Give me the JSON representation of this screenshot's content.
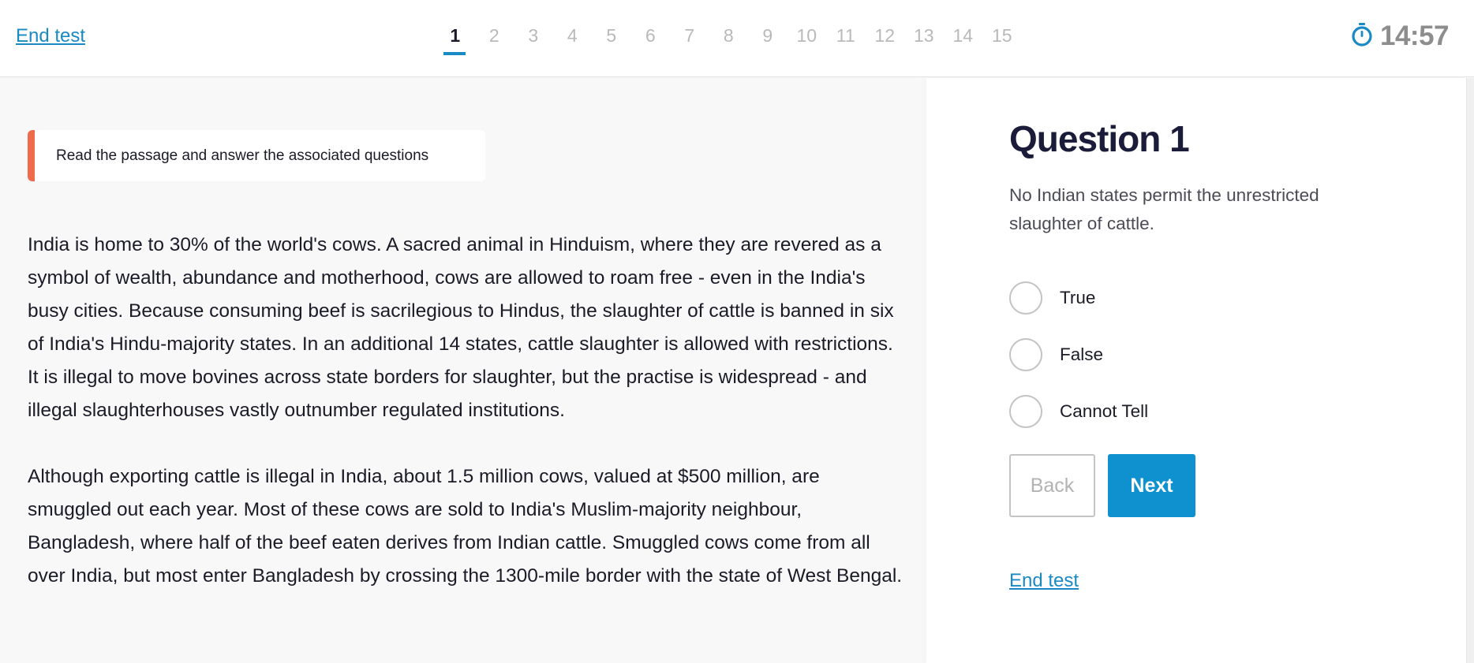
{
  "header": {
    "end_test_label": "End test",
    "question_numbers": [
      "1",
      "2",
      "3",
      "4",
      "5",
      "6",
      "7",
      "8",
      "9",
      "10",
      "11",
      "12",
      "13",
      "14",
      "15"
    ],
    "active_question": "1",
    "timer": "14:57",
    "timer_icon": "stopwatch-icon"
  },
  "passage": {
    "instruction": "Read the passage and answer the associated questions",
    "paragraphs": [
      "India is home to 30% of the world's cows. A sacred animal in Hinduism, where they are revered as a symbol of wealth, abundance and motherhood, cows are allowed to roam free - even in the India's busy cities. Because consuming beef is sacrilegious to Hindus, the slaughter of cattle is banned in six of India's Hindu-majority states. In an additional 14 states, cattle slaughter is allowed with restrictions. It is illegal to move bovines across state borders for slaughter, but the practise is widespread - and illegal slaughterhouses vastly outnumber regulated institutions.",
      "Although exporting cattle is illegal in India, about 1.5 million cows, valued at $500 million, are smuggled out each year. Most of these cows are sold to India's Muslim-majority neighbour, Bangladesh, where half of the beef eaten derives from Indian cattle. Smuggled cows come from all over India, but most enter Bangladesh by crossing the 1300-mile border with the state of West Bengal."
    ]
  },
  "question": {
    "title": "Question 1",
    "statement": "No Indian states permit the unrestricted slaughter of cattle.",
    "options": [
      "True",
      "False",
      "Cannot Tell"
    ],
    "selected": null,
    "back_label": "Back",
    "next_label": "Next",
    "end_test_label": "End test"
  },
  "colors": {
    "accent": "#1a8ac4",
    "next_button": "#0f90cf",
    "banner_border": "#ef6b4c",
    "timer_text": "#8d8d8d"
  }
}
